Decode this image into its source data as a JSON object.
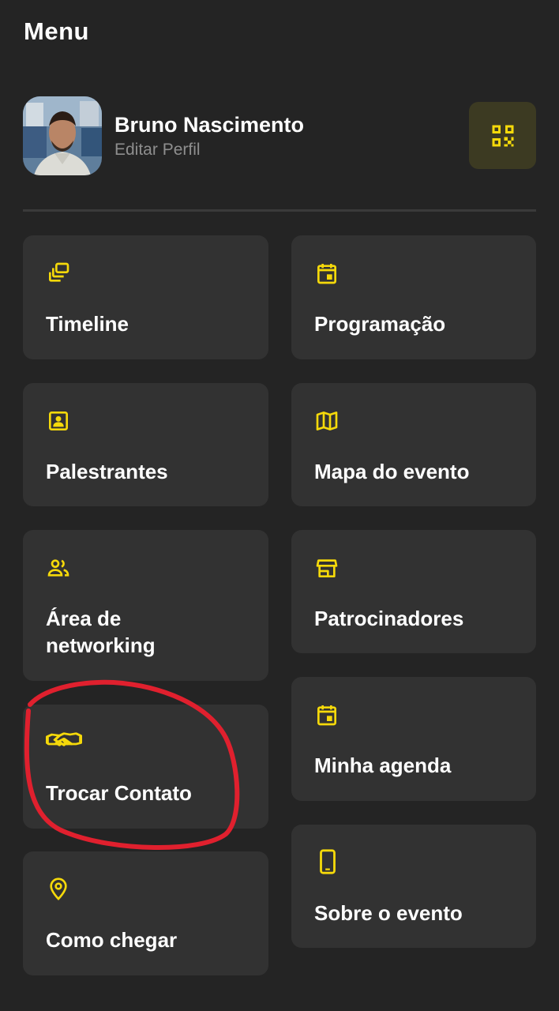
{
  "header": {
    "title": "Menu"
  },
  "profile": {
    "name": "Bruno Nascimento",
    "edit_label": "Editar Perfil",
    "qr_icon": "qr-code-icon"
  },
  "menu": {
    "timeline": {
      "label": "Timeline",
      "icon": "layers-icon"
    },
    "programacao": {
      "label": "Programação",
      "icon": "calendar-icon"
    },
    "palestrantes": {
      "label": "Palestrantes",
      "icon": "contact-card-icon"
    },
    "mapa": {
      "label": "Mapa do evento",
      "icon": "map-icon"
    },
    "networking": {
      "label_line1": "Área de",
      "label_line2": "networking",
      "icon": "people-icon"
    },
    "patrocinadores": {
      "label": "Patrocinadores",
      "icon": "store-icon"
    },
    "trocar": {
      "label": "Trocar Contato",
      "icon": "handshake-icon"
    },
    "agenda": {
      "label": "Minha agenda",
      "icon": "calendar-icon"
    },
    "como_chegar": {
      "label": "Como chegar",
      "icon": "location-pin-icon"
    },
    "sobre": {
      "label": "Sobre o evento",
      "icon": "smartphone-icon"
    }
  },
  "colors": {
    "background": "#242424",
    "card": "#323232",
    "accent": "#f5d90a",
    "annotation": "#e0202e"
  }
}
